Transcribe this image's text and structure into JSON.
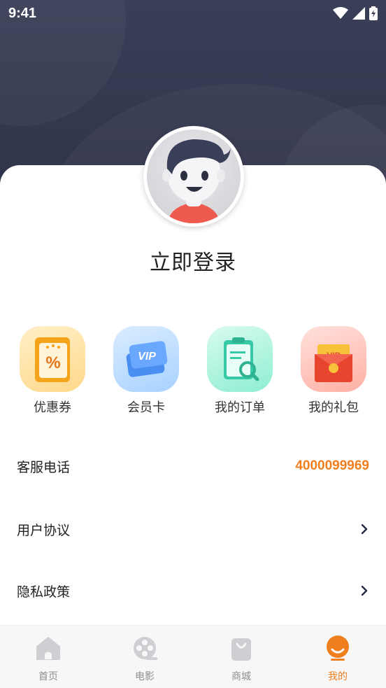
{
  "status_bar": {
    "time": "9:41"
  },
  "profile": {
    "login_text": "立即登录"
  },
  "quick_actions": [
    {
      "label": "优惠券",
      "icon": "coupon-icon"
    },
    {
      "label": "会员卡",
      "icon": "vip-card-icon"
    },
    {
      "label": "我的订单",
      "icon": "order-icon"
    },
    {
      "label": "我的礼包",
      "icon": "gift-pack-icon"
    }
  ],
  "menu": {
    "service_label": "客服电话",
    "service_phone": "4000099969",
    "agreement_label": "用户协议",
    "privacy_label": "隐私政策"
  },
  "tabbar": {
    "tabs": [
      {
        "label": "首页",
        "icon": "home-icon"
      },
      {
        "label": "电影",
        "icon": "film-reel-icon"
      },
      {
        "label": "商城",
        "icon": "shopping-bag-icon"
      },
      {
        "label": "我的",
        "icon": "profile-icon"
      }
    ],
    "active_index": 3
  },
  "colors": {
    "accent": "#f07f1e",
    "header_bg": "#353a52"
  }
}
